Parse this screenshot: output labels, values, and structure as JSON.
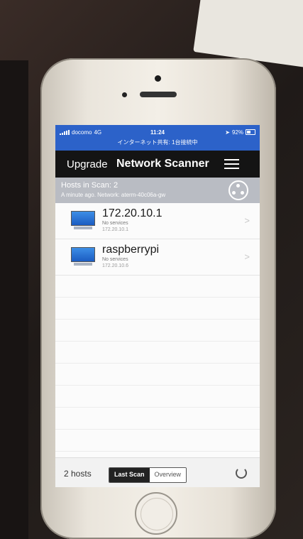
{
  "status_bar": {
    "carrier": "docomo",
    "network": "4G",
    "time": "11:24",
    "battery": "92%",
    "subtitle": "インターネット共有: 1台接続中"
  },
  "navbar": {
    "upgrade_label": "Upgrade",
    "title": "Network Scanner",
    "menu_icon": "hamburger-menu-icon"
  },
  "scan_header": {
    "title": "Hosts in Scan: 2",
    "subtitle": "A minute ago. Network: aterm-40c06a-gw",
    "scan_icon": "network-hub-icon"
  },
  "hosts": [
    {
      "name": "172.20.10.1",
      "services": "No services",
      "ip": "172.20.10.1"
    },
    {
      "name": "raspberrypi",
      "services": "No services",
      "ip": "172.20.10.6"
    }
  ],
  "bottom_bar": {
    "hosts_count": "2 hosts",
    "tabs": [
      "Last Scan",
      "Overview"
    ],
    "selected_tab": "Last Scan",
    "refresh_icon": "refresh-icon"
  },
  "colors": {
    "status_bar": "#2c62c9",
    "navbar": "#141414",
    "scan_header": "#b9bcc3"
  }
}
